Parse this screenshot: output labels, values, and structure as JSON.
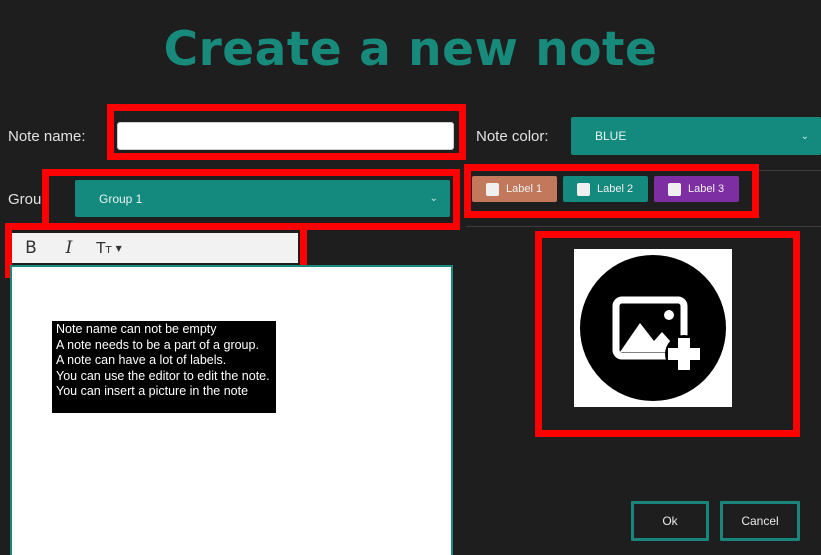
{
  "title": "Create a new note",
  "note_name": {
    "label": "Note name:",
    "value": "",
    "placeholder": ""
  },
  "group": {
    "label": "Group",
    "selected": "Group 1"
  },
  "note_color": {
    "label": "Note color:",
    "selected": "BLUE"
  },
  "labels": [
    {
      "text": "Label 1",
      "color": "#c2785a",
      "checked": false
    },
    {
      "text": "Label 2",
      "color": "#138a7d",
      "checked": false
    },
    {
      "text": "Label 3",
      "color": "#7d2ea3",
      "checked": false
    }
  ],
  "toolbar": {
    "bold": "B",
    "italic": "I",
    "text_size_icon": "text-size-icon"
  },
  "hints": [
    "Note name can not be empty",
    "A note needs to be a part of a group.",
    "A note can have a lot of labels.",
    "You can use the editor to edit the note.",
    "You can insert a picture in the note"
  ],
  "picture": {
    "icon": "add-image-icon"
  },
  "buttons": {
    "ok": "Ok",
    "cancel": "Cancel"
  },
  "colors": {
    "accent": "#178a7c",
    "highlight": "#ff0000",
    "background": "#1e1e1e"
  }
}
